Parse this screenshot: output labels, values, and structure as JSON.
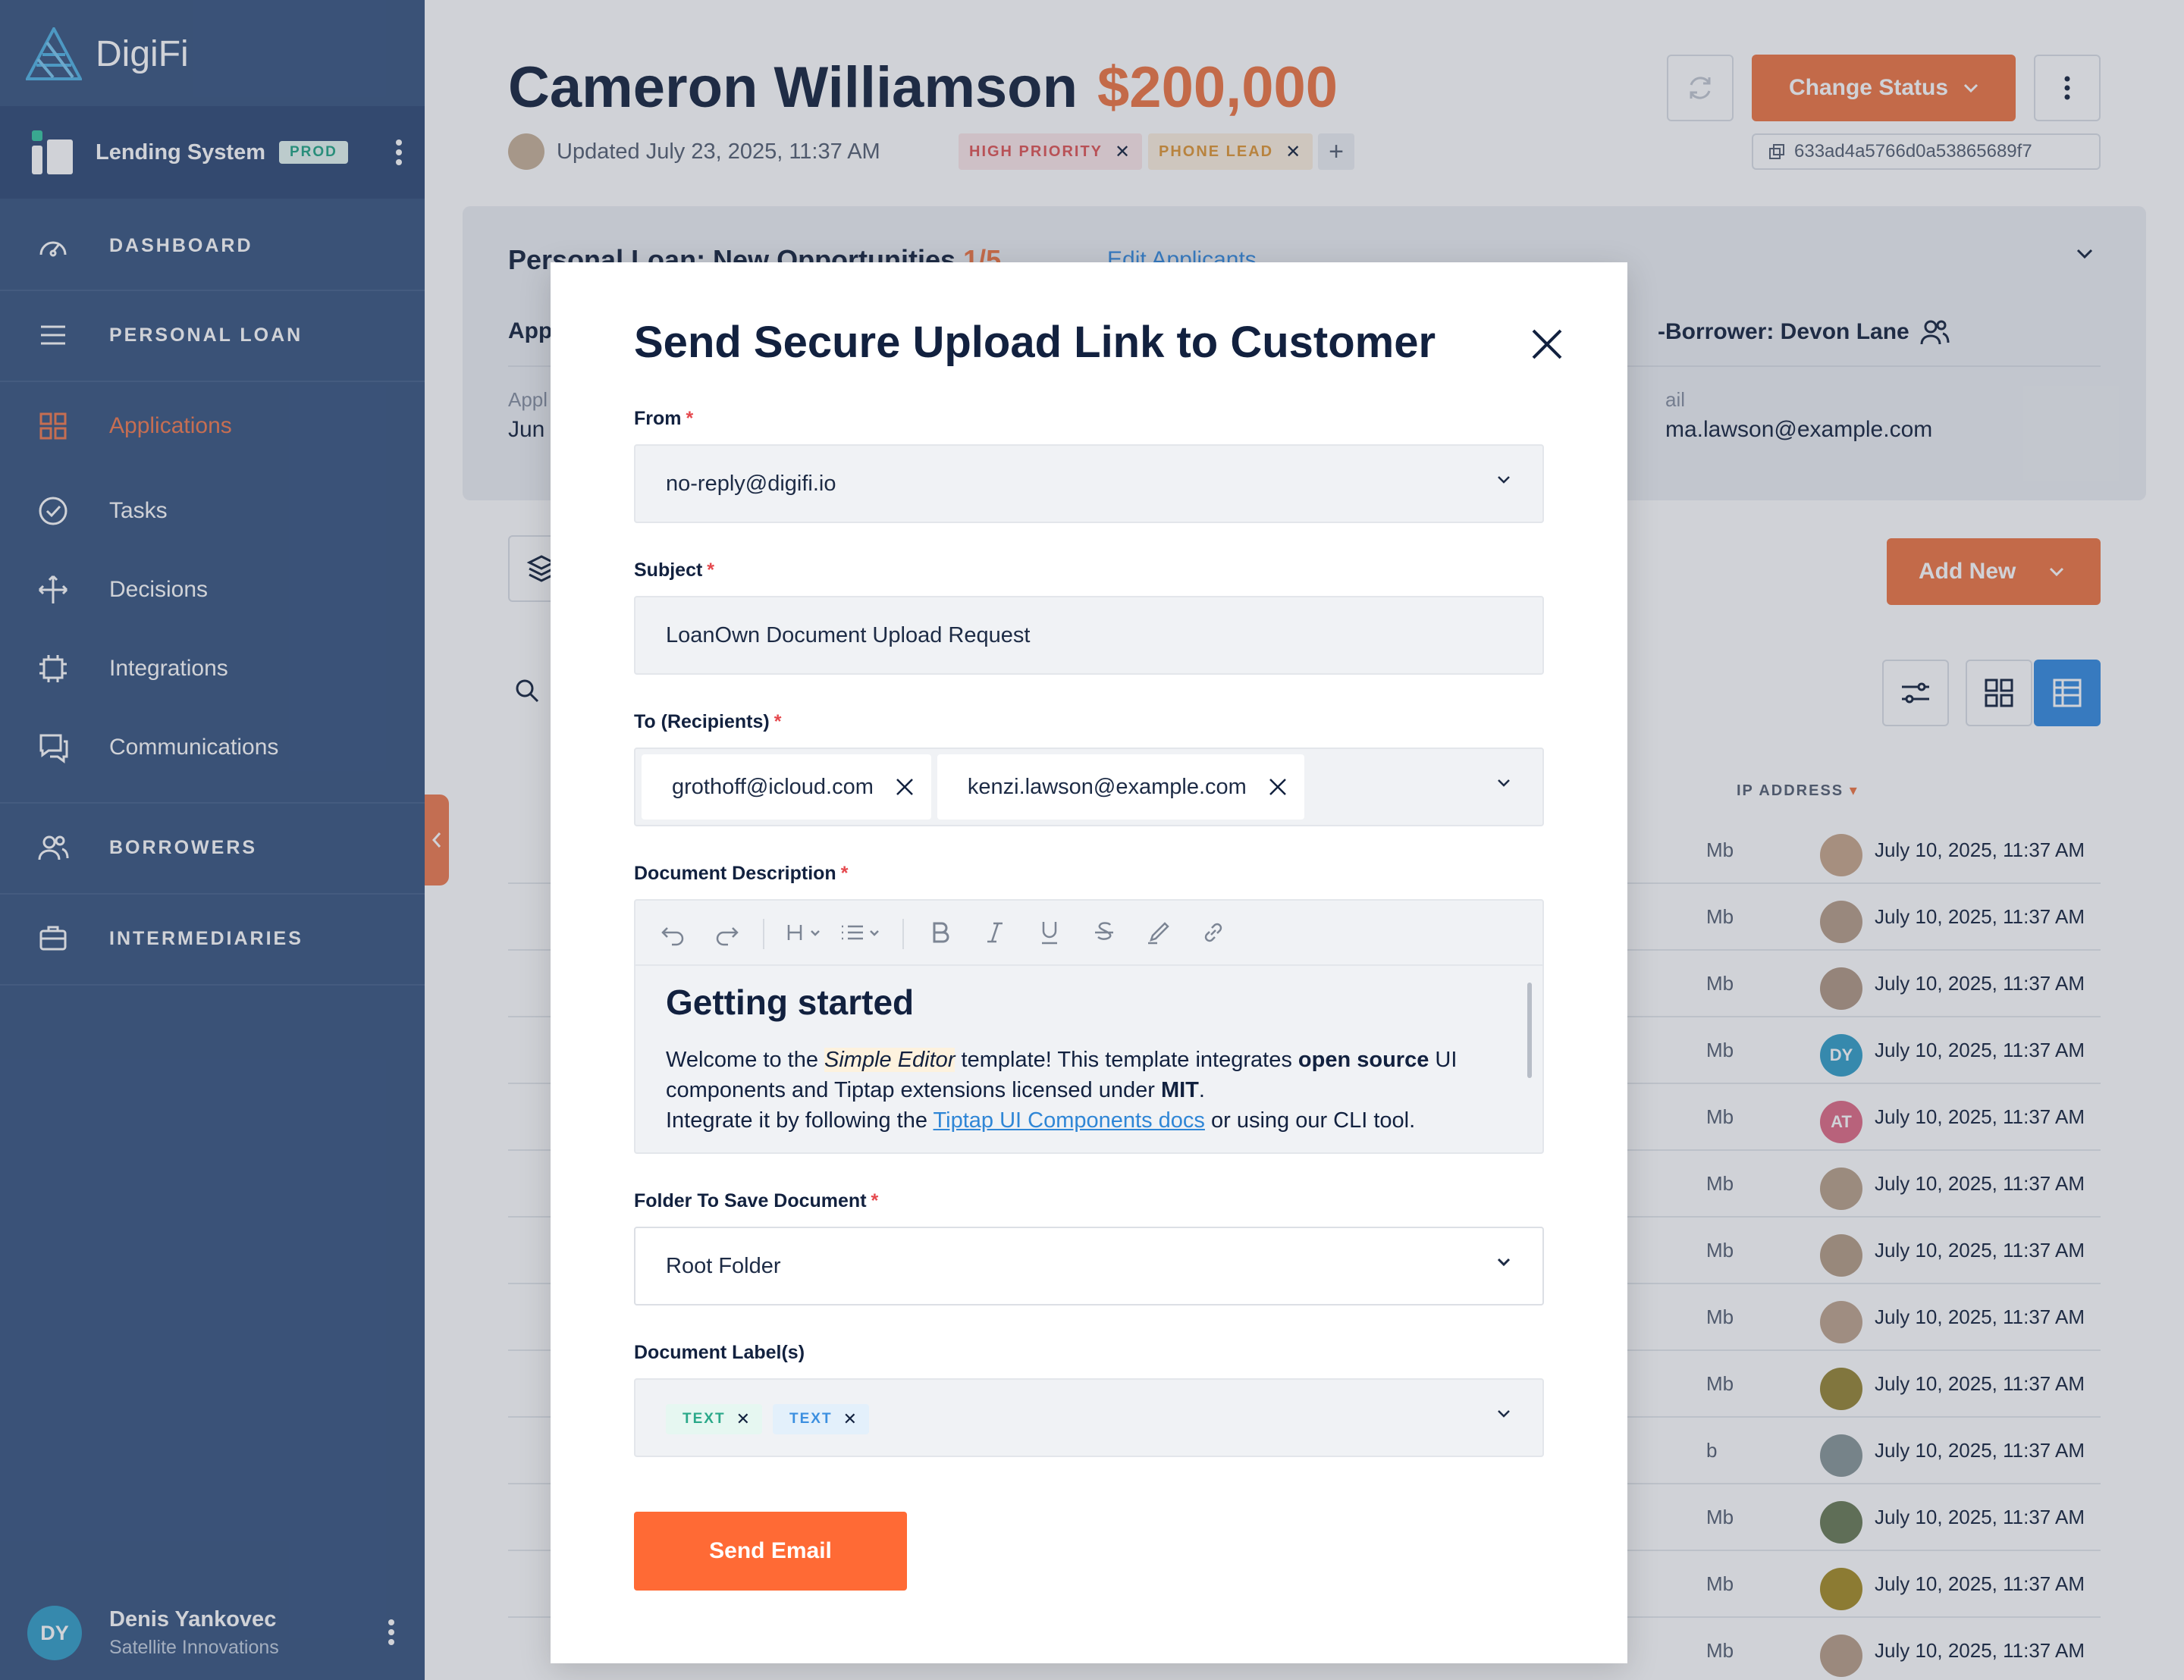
{
  "sidebar": {
    "brand": "DigiFi",
    "system_name": "Lending System",
    "env_badge": "PROD",
    "nav": {
      "dashboard": "DASHBOARD",
      "personal_loan": "PERSONAL LOAN",
      "applications": "Applications",
      "tasks": "Tasks",
      "decisions": "Decisions",
      "integrations": "Integrations",
      "communications": "Communications",
      "borrowers": "BORROWERS",
      "intermediaries": "INTERMEDIARIES"
    },
    "user": {
      "initials": "DY",
      "name": "Denis Yankovec",
      "org": "Satellite Innovations"
    },
    "active_color": "#f27f55"
  },
  "header": {
    "name": "Cameron Williamson",
    "amount": "$200,000",
    "updated": "Updated July 23, 2025, 11:37 AM",
    "tags": [
      "HIGH PRIORITY",
      "PHONE LEAD"
    ],
    "change_status": "Change Status",
    "app_id": "633ad4a5766d0a53865689f7"
  },
  "card": {
    "title": "Personal Loan: New Opportunities",
    "count": "1/5",
    "edit": "Edit Applicants",
    "applicant_partial": "App",
    "co_borrower": "-Borrower: Devon Lane",
    "label_left_partial": "Appl",
    "value_left_partial": "Jun",
    "label_right_partial": "ail",
    "value_right_partial": "ma.lawson@example.com"
  },
  "toolbar": {
    "add_new": "Add New"
  },
  "table": {
    "ip_header": "IP ADDRESS",
    "rows": [
      {
        "size": "Mb",
        "date": "July 10, 2025, 11:37 AM",
        "avatar": ""
      },
      {
        "size": "Mb",
        "date": "July 10, 2025, 11:37 AM",
        "avatar": ""
      },
      {
        "size": "Mb",
        "date": "July 10, 2025, 11:37 AM",
        "avatar": ""
      },
      {
        "size": "Mb",
        "date": "July 10, 2025, 11:37 AM",
        "avatar": "DY"
      },
      {
        "size": "Mb",
        "date": "July 10, 2025, 11:37 AM",
        "avatar": "AT"
      },
      {
        "size": "Mb",
        "date": "July 10, 2025, 11:37 AM",
        "avatar": ""
      },
      {
        "size": "Mb",
        "date": "July 10, 2025, 11:37 AM",
        "avatar": ""
      },
      {
        "size": "Mb",
        "date": "July 10, 2025, 11:37 AM",
        "avatar": ""
      },
      {
        "size": "Mb",
        "date": "July 10, 2025, 11:37 AM",
        "avatar": ""
      },
      {
        "size": "b",
        "date": "July 10, 2025, 11:37 AM",
        "avatar": ""
      },
      {
        "size": "Mb",
        "date": "July 10, 2025, 11:37 AM",
        "avatar": ""
      },
      {
        "size": "Mb",
        "date": "July 10, 2025, 11:37 AM",
        "avatar": ""
      },
      {
        "size": "Mb",
        "date": "July 10, 2025, 11:37 AM",
        "avatar": ""
      }
    ]
  },
  "modal": {
    "title": "Send Secure Upload Link to Customer",
    "from_label": "From",
    "from_value": "no-reply@digifi.io",
    "subject_label": "Subject",
    "subject_value": "LoanOwn Document Upload Request",
    "to_label": "To (Recipients)",
    "recipients": [
      "grothoff@icloud.com",
      "kenzi.lawson@example.com"
    ],
    "desc_label": "Document Description",
    "editor": {
      "heading": "Getting started",
      "p1": "Welcome to the ",
      "p1_em": "Simple Editor",
      "p1_b": " template! This template integrates ",
      "p1_strong1": "open source",
      "p1_c": " UI components and Tiptap extensions licensed under ",
      "p1_strong2": "MIT",
      "p1_d": ".",
      "p2": "Integrate it by following the ",
      "p2_link": "Tiptap UI Components docs",
      "p2_b": " or using our CLI tool."
    },
    "folder_label": "Folder To Save Document",
    "folder_value": "Root Folder",
    "labels_label": "Document Label(s)",
    "doc_labels": [
      "TEXT",
      "TEXT"
    ],
    "send": "Send Email",
    "accent": "#ff6a35"
  }
}
